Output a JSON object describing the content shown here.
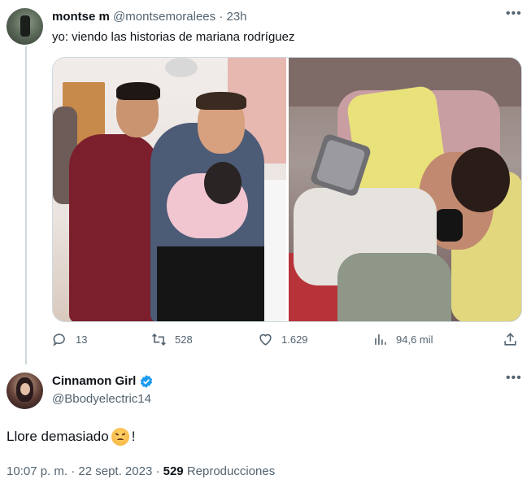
{
  "tweet": {
    "author_name": "montse m",
    "author_handle": "@montsemoralees",
    "separator": "·",
    "time": "23h",
    "more_label": "•••",
    "text": "yo: viendo las historias de mariana rodríguez",
    "stats": {
      "replies": "13",
      "retweets": "528",
      "likes": "1.629",
      "views": "94,6 mil"
    }
  },
  "reply": {
    "author_name": "Cinnamon Girl",
    "author_handle": "@Bbodyelectric14",
    "verified": true,
    "more_label": "•••",
    "text": "Llore demasiado",
    "text_suffix": "!",
    "emoji": "persevering-face-emoji",
    "timestamp": "10:07 p. m. · 22 sept. 2023 ·",
    "views_count": "529",
    "views_label": "Reproducciones"
  },
  "colors": {
    "text_primary": "#0f1419",
    "text_secondary": "#536471",
    "verified_blue": "#1d9bf0",
    "border": "#cfd9de"
  }
}
